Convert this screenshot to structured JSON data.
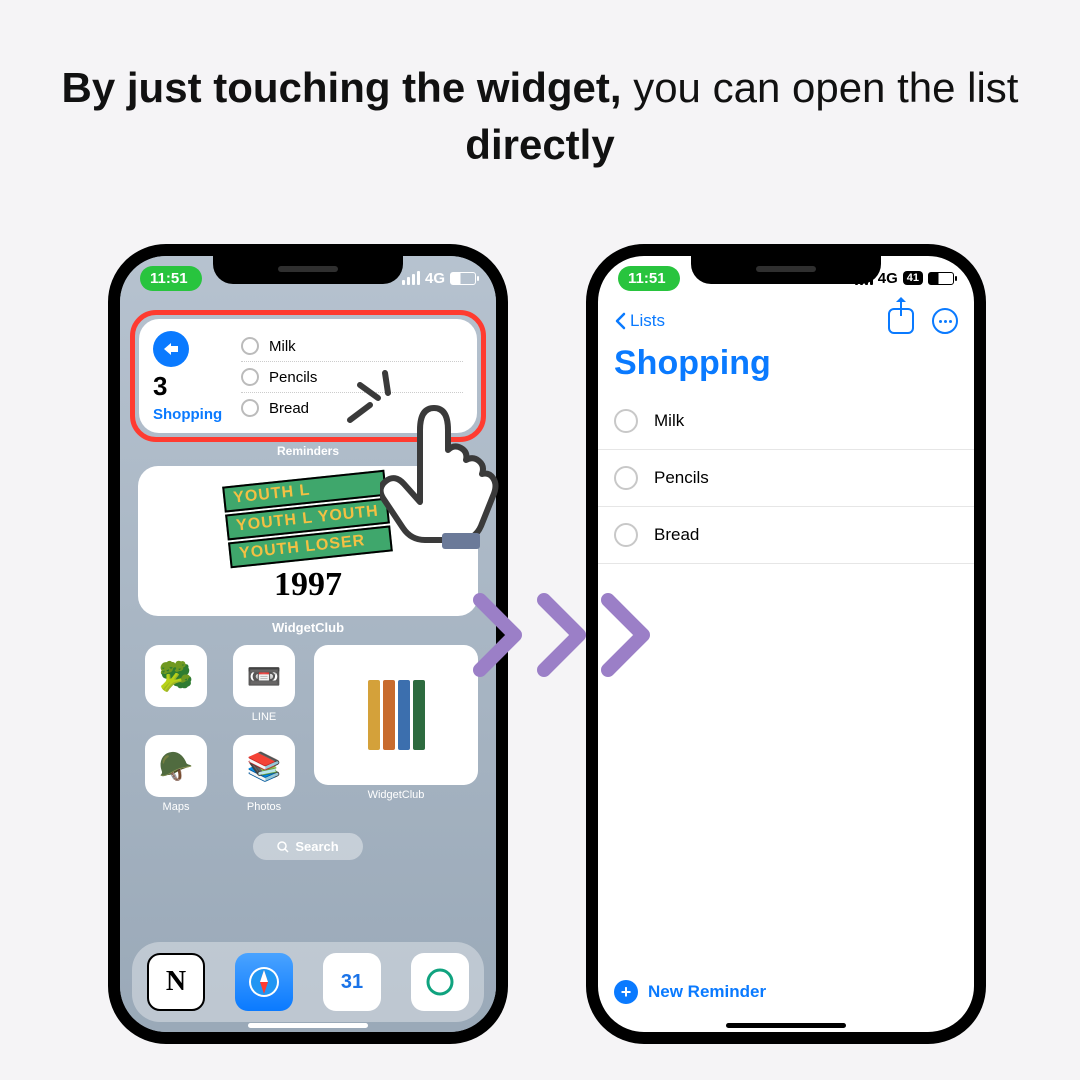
{
  "headline": {
    "p1_bold": "By just touching the widget,",
    "p2": " you can open the list ",
    "p3_bold": "directly"
  },
  "status": {
    "time": "11:51",
    "carrier": "4G",
    "battery": "41"
  },
  "left": {
    "widget": {
      "items": [
        "Milk",
        "Pencils",
        "Bread"
      ],
      "count": "3",
      "name": "Shopping",
      "caption": "Reminders"
    },
    "poster": {
      "tags": [
        "YOUTH L",
        "YOUTH L YOUTH",
        "YOUTH LOSER"
      ],
      "year": "1997",
      "label": "WidgetClub"
    },
    "apps": [
      {
        "label": "",
        "emoji": "🥦"
      },
      {
        "label": "LINE",
        "emoji": "📼"
      },
      {
        "label": "Maps",
        "emoji": "🪖"
      },
      {
        "label": "Photos",
        "emoji": "📚"
      }
    ],
    "bigtile_label": "WidgetClub",
    "search": "Search",
    "dock": [
      "N",
      "safari",
      "31",
      "chatgpt"
    ]
  },
  "right": {
    "back": "Lists",
    "title": "Shopping",
    "items": [
      "Milk",
      "Pencils",
      "Bread"
    ],
    "new": "New Reminder"
  }
}
